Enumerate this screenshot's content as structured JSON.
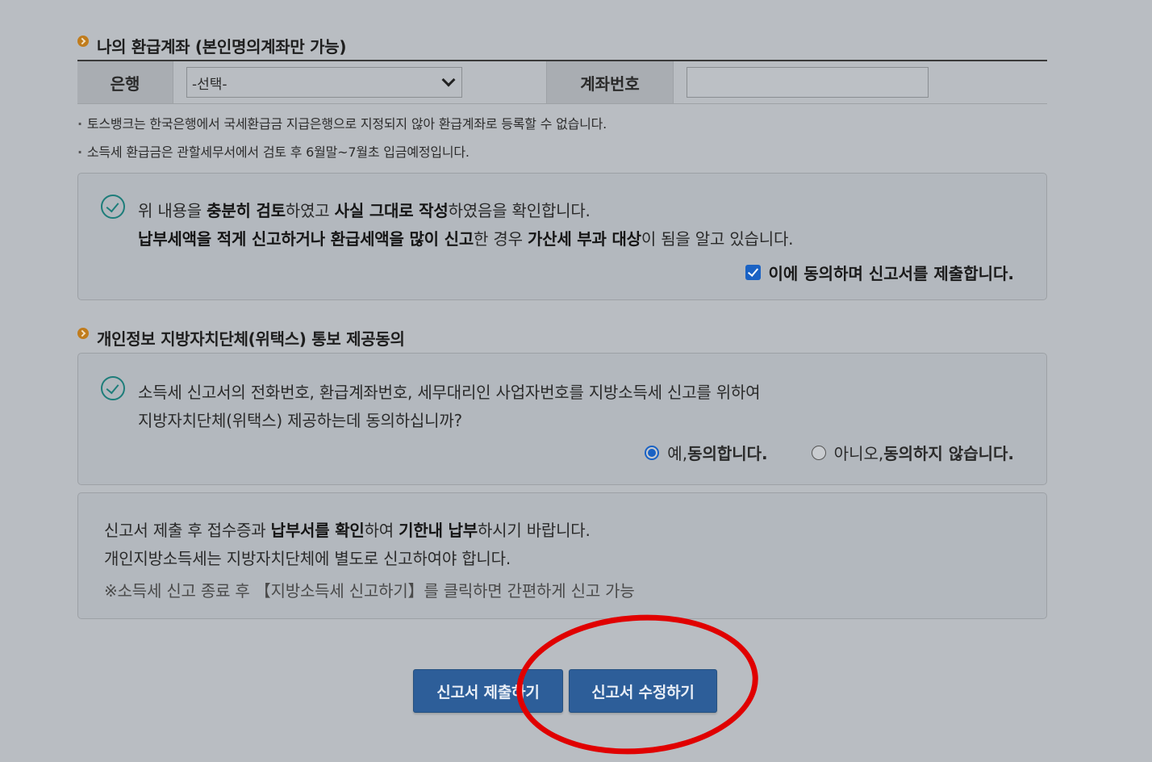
{
  "refund_account": {
    "title": "나의 환급계좌 (본인명의계좌만 가능)",
    "bank_label": "은행",
    "bank_select_value": "-선택-",
    "account_label": "계좌번호",
    "account_value": "",
    "notes": [
      "토스뱅크는 한국은행에서 국세환급금 지급은행으로 지정되지 않아 환급계좌로 등록할 수 없습니다.",
      "소득세 환급금은 관할세무서에서 검토 후 6월말~7월초 입금예정입니다."
    ]
  },
  "confirm_panel": {
    "line1": {
      "p1": "위 내용을 ",
      "b1": "충분히 검토",
      "p2": "하였고 ",
      "b2": "사실 그대로 작성",
      "p3": "하였음을 확인합니다."
    },
    "line2": {
      "b1": "납부세액을 적게 신고하거나 환급세액을 많이 신고",
      "p1": "한 경우 ",
      "b2": "가산세 부과 대상",
      "p2": "이 됨을 알고 있습니다."
    },
    "agree_label": "이에 동의하며 신고서를 제출합니다.",
    "agree_checked": true
  },
  "privacy": {
    "title": "개인정보 지방자치단체(위택스) 통보 제공동의",
    "line1": "소득세 신고서의 전화번호, 환급계좌번호, 세무대리인 사업자번호를 지방소득세 신고를 위하여",
    "line2": "지방자치단체(위택스) 제공하는데 동의하십니까?",
    "yes_prefix": "예, ",
    "yes_bold": "동의합니다.",
    "no_prefix": "아니오, ",
    "no_bold": "동의하지 않습니다.",
    "selected": "yes"
  },
  "info_panel": {
    "line1": {
      "p1": "신고서 제출 후 접수증과 ",
      "b1": "납부서를 확인",
      "p2": "하여 ",
      "b2": "기한내 납부",
      "p3": "하시기 바랍니다."
    },
    "line2": "개인지방소득세는 지방자치단체에 별도로 신고하여야 합니다.",
    "line3": "※소득세 신고 종료 후 【지방소득세 신고하기】를 클릭하면 간편하게 신고 가능"
  },
  "buttons": {
    "submit": "신고서 제출하기",
    "edit": "신고서 수정하기"
  },
  "colors": {
    "background": "#b9bdc2",
    "button": "#2d5e99",
    "check_teal": "#1e7d7a",
    "highlight_circle": "#e00000"
  }
}
